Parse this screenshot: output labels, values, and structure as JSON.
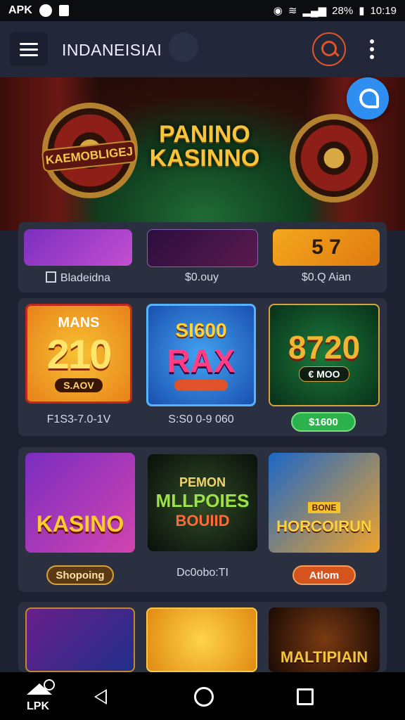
{
  "statusbar": {
    "left_text": "APK",
    "battery_text": "28%",
    "time": "10:19"
  },
  "appbar": {
    "title": "INDANEISIAI"
  },
  "hero": {
    "title_line1": "PANINO",
    "title_line2": "KASINNO",
    "badge": "KAEMOBLIGEJ"
  },
  "row1": {
    "labels": [
      "Bladeidna",
      "$0.ouy",
      "$0.Q Aian"
    ],
    "tile3_text": "5 7"
  },
  "row2": {
    "tile1": {
      "top": "MANS",
      "num": "210",
      "tag": "S.AOV"
    },
    "tile2": {
      "top": "SI600",
      "main": "RAX"
    },
    "tile3": {
      "num": "8720",
      "tag": "€ MOO"
    },
    "labels": [
      "F1S3-7.0-1V",
      "S:S0 0-9 060"
    ],
    "button3": "$1600"
  },
  "row3": {
    "tile1": "KASINO",
    "tile2": {
      "l1": "PEMON",
      "l2": "MLLPOIES",
      "l3": "BOUIID"
    },
    "tile3": {
      "badge": "BONE",
      "main": "HORCOIRUN"
    },
    "button1": "Shopoing",
    "label2": "Dc0obo:TI",
    "button3": "Atlom"
  },
  "row4": {
    "tile3": "MALTIPIAIN"
  },
  "navbar": {
    "apk_label": "LPK"
  },
  "colors": {
    "accent": "#e0532a",
    "chat": "#2f8ff0",
    "green_button": "#2bb24c"
  }
}
